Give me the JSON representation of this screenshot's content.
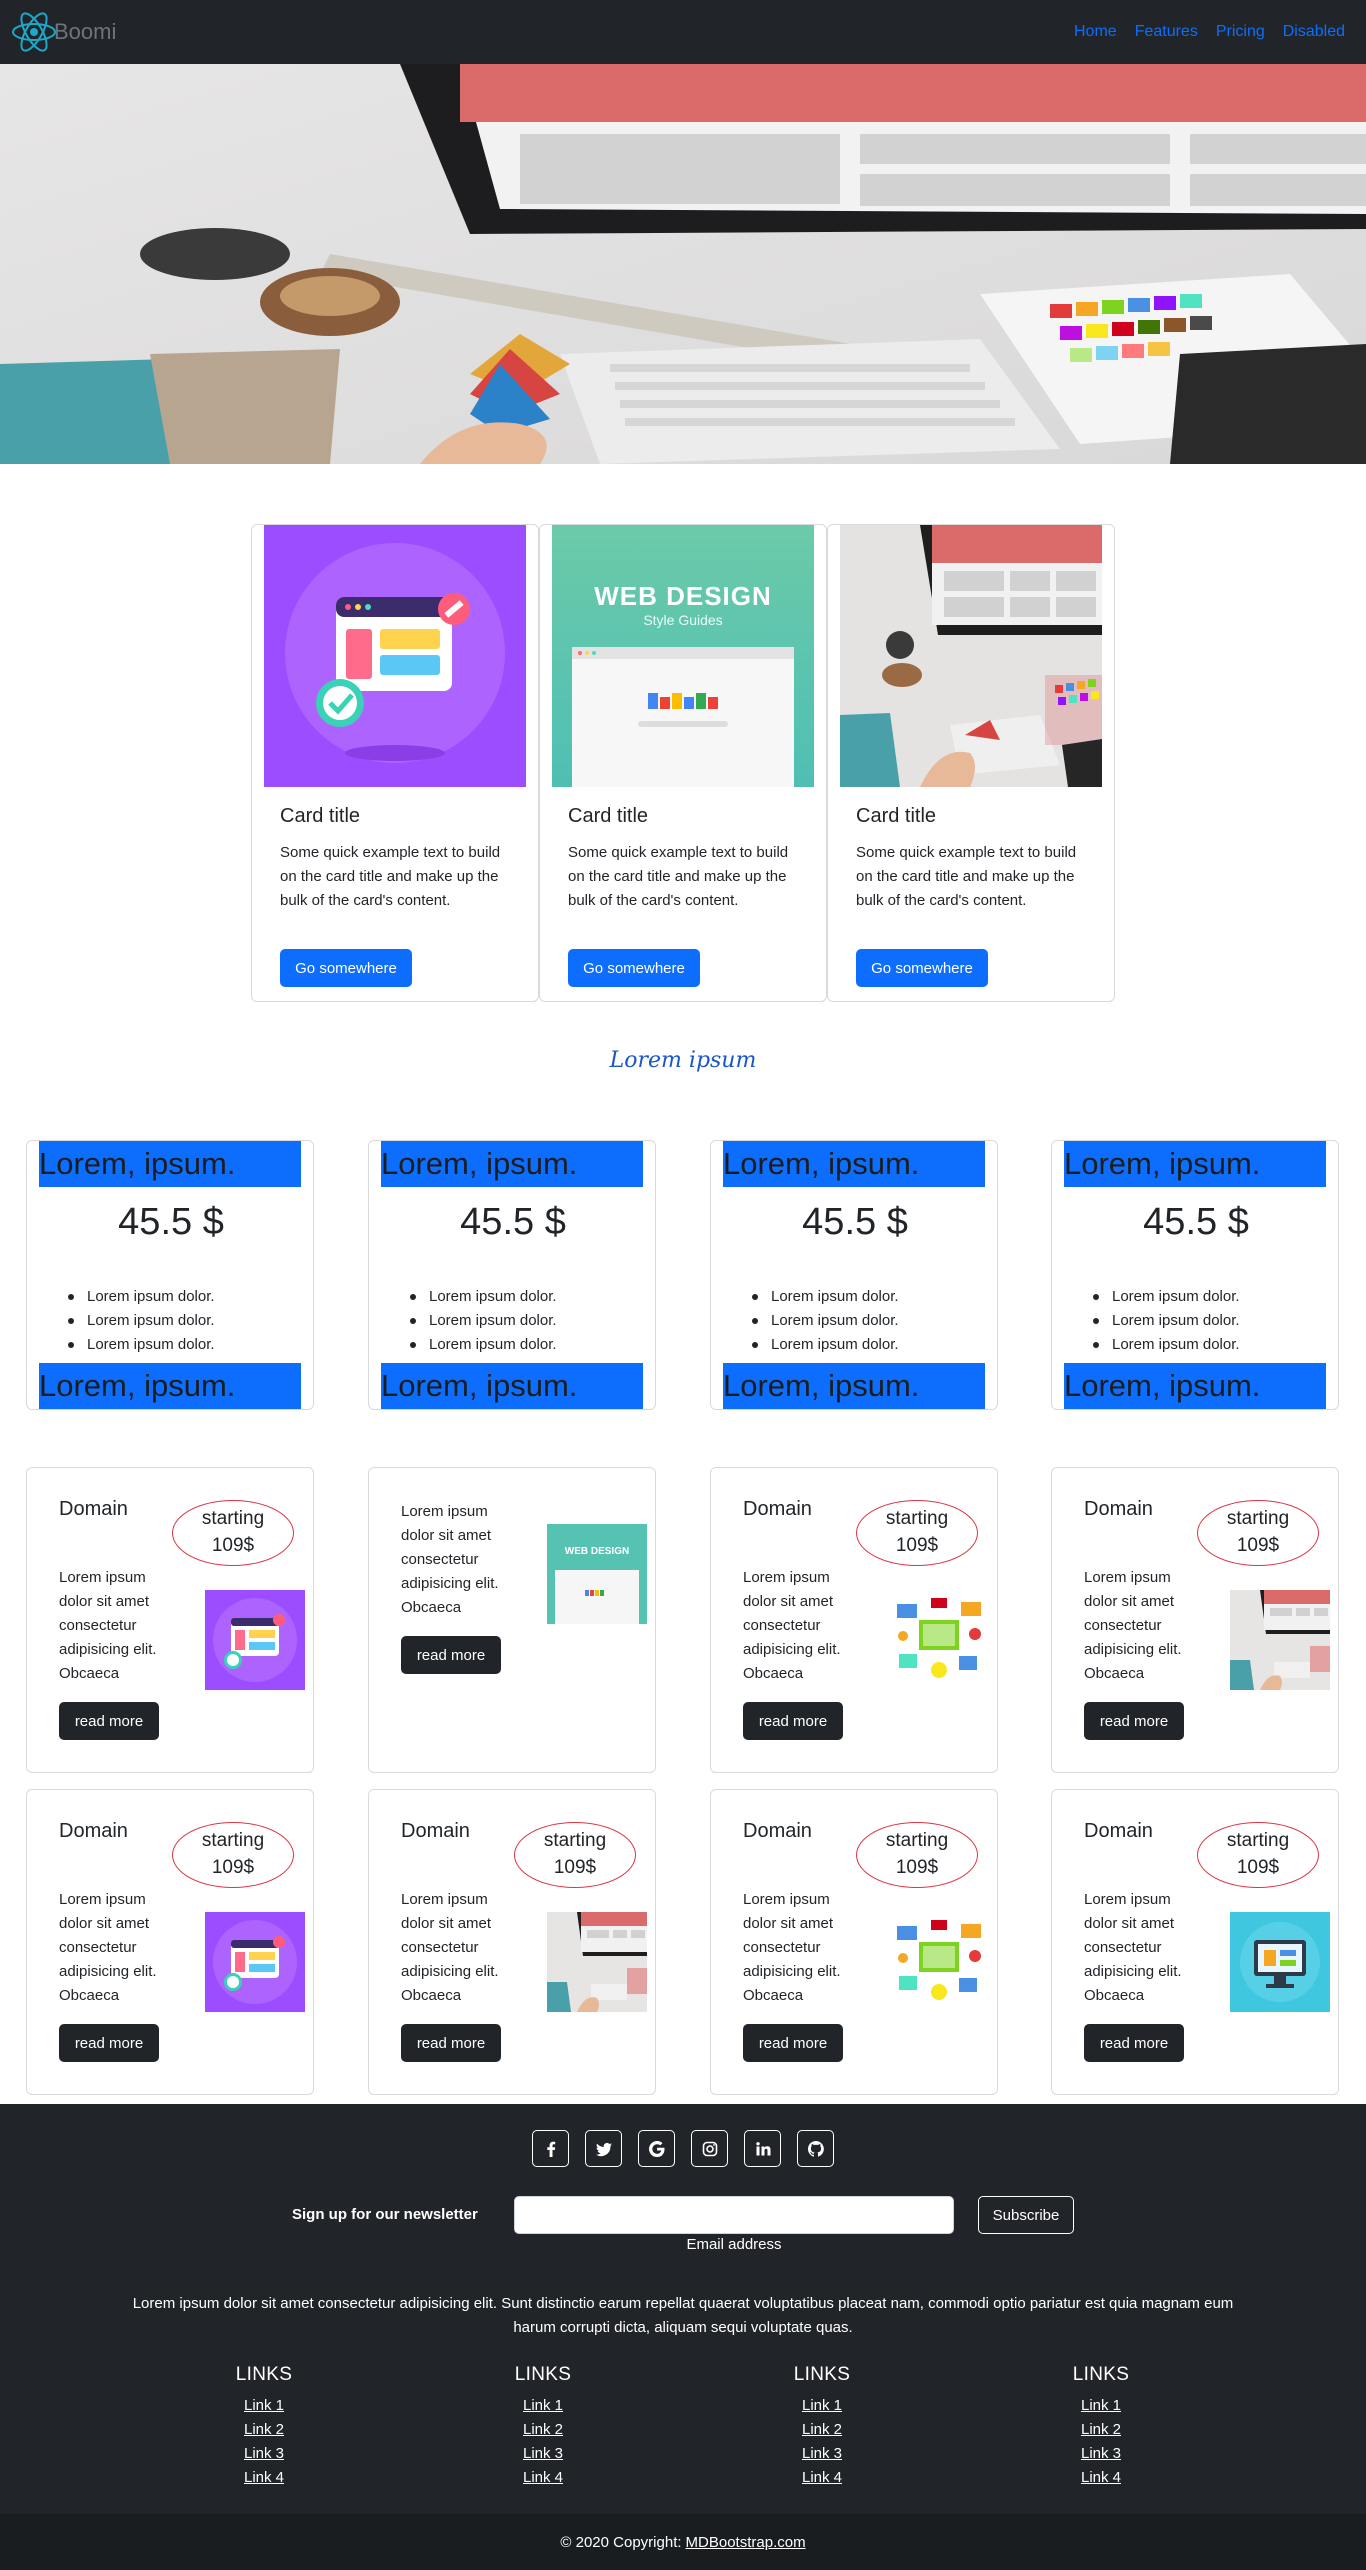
{
  "navbar": {
    "brand": "Boomi",
    "links": [
      "Home",
      "Features",
      "Pricing",
      "Disabled"
    ]
  },
  "cards": [
    {
      "title": "Card title",
      "text": "Some quick example text to build on the card title and make up the bulk of the card's content.",
      "button": "Go somewhere",
      "image": "browser-window-illustration"
    },
    {
      "title": "Card title",
      "text": "Some quick example text to build on the card title and make up the bulk of the card's content.",
      "button": "Go somewhere",
      "image": "web-design-style-guides",
      "image_text": [
        "WEB DESIGN",
        "Style Guides"
      ]
    },
    {
      "title": "Card title",
      "text": "Some quick example text to build on the card title and make up the bulk of the card's content.",
      "button": "Go somewhere",
      "image": "desk-photo"
    }
  ],
  "section_heading": "Lorem ipsum",
  "pricing": [
    {
      "header": "Lorem, ipsum.",
      "price": "45.5 $",
      "features": [
        "Lorem ipsum dolor.",
        "Lorem ipsum dolor.",
        "Lorem ipsum dolor."
      ],
      "footer": "Lorem, ipsum."
    },
    {
      "header": "Lorem, ipsum.",
      "price": "45.5 $",
      "features": [
        "Lorem ipsum dolor.",
        "Lorem ipsum dolor.",
        "Lorem ipsum dolor."
      ],
      "footer": "Lorem, ipsum."
    },
    {
      "header": "Lorem, ipsum.",
      "price": "45.5 $",
      "features": [
        "Lorem ipsum dolor.",
        "Lorem ipsum dolor.",
        "Lorem ipsum dolor."
      ],
      "footer": "Lorem, ipsum."
    },
    {
      "header": "Lorem, ipsum.",
      "price": "45.5 $",
      "features": [
        "Lorem ipsum dolor.",
        "Lorem ipsum dolor.",
        "Lorem ipsum dolor."
      ],
      "footer": "Lorem, ipsum."
    }
  ],
  "domains": [
    {
      "title": "Domain",
      "badge": [
        "starting",
        "109$"
      ],
      "text": "Lorem ipsum dolor sit amet consectetur adipisicing elit. Obcaeca",
      "button": "read more",
      "image": "browser-window-illustration"
    },
    {
      "title": "",
      "badge": [],
      "text": "Lorem ipsum dolor sit amet consectetur adipisicing elit. Obcaeca",
      "button": "read more",
      "image": "web-design-style-guides"
    },
    {
      "title": "Domain",
      "badge": [
        "starting",
        "109$"
      ],
      "text": "Lorem ipsum dolor sit amet consectetur adipisicing elit. Obcaeca",
      "button": "read more",
      "image": "devices-collage"
    },
    {
      "title": "Domain",
      "badge": [
        "starting",
        "109$"
      ],
      "text": "Lorem ipsum dolor sit amet consectetur adipisicing elit. Obcaeca",
      "button": "read more",
      "image": "desk-photo"
    },
    {
      "title": "Domain",
      "badge": [
        "starting",
        "109$"
      ],
      "text": "Lorem ipsum dolor sit amet consectetur adipisicing elit. Obcaeca",
      "button": "read more",
      "image": "browser-window-illustration"
    },
    {
      "title": "Domain",
      "badge": [
        "starting",
        "109$"
      ],
      "text": "Lorem ipsum dolor sit amet consectetur adipisicing elit. Obcaeca",
      "button": "read more",
      "image": "desk-photo"
    },
    {
      "title": "Domain",
      "badge": [
        "starting",
        "109$"
      ],
      "text": "Lorem ipsum dolor sit amet consectetur adipisicing elit. Obcaeca",
      "button": "read more",
      "image": "devices-collage"
    },
    {
      "title": "Domain",
      "badge": [
        "starting",
        "109$"
      ],
      "text": "Lorem ipsum dolor sit amet consectetur adipisicing elit. Obcaeca",
      "button": "read more",
      "image": "monitor-illustration"
    }
  ],
  "footer": {
    "socials": [
      "facebook-icon",
      "twitter-icon",
      "google-icon",
      "instagram-icon",
      "linkedin-icon",
      "github-icon"
    ],
    "newsletter_label": "Sign up for our newsletter",
    "email_label": "Email address",
    "subscribe": "Subscribe",
    "paragraph": "Lorem ipsum dolor sit amet consectetur adipisicing elit. Sunt distinctio earum repellat quaerat voluptatibus placeat nam, commodi optio pariatur est quia magnam eum harum corrupti dicta, aliquam sequi voluptate quas.",
    "link_columns": [
      {
        "heading": "LINKS",
        "links": [
          "Link 1",
          "Link 2",
          "Link 3",
          "Link 4"
        ]
      },
      {
        "heading": "LINKS",
        "links": [
          "Link 1",
          "Link 2",
          "Link 3",
          "Link 4"
        ]
      },
      {
        "heading": "LINKS",
        "links": [
          "Link 1",
          "Link 2",
          "Link 3",
          "Link 4"
        ]
      },
      {
        "heading": "LINKS",
        "links": [
          "Link 1",
          "Link 2",
          "Link 3",
          "Link 4"
        ]
      }
    ],
    "copyright": "© 2020 Copyright:",
    "copyright_link": "MDBootstrap.com"
  },
  "colors": {
    "primary": "#0d6efd",
    "dark": "#212529",
    "badge_border": "#dc3545",
    "heading_script": "#1957c7"
  }
}
